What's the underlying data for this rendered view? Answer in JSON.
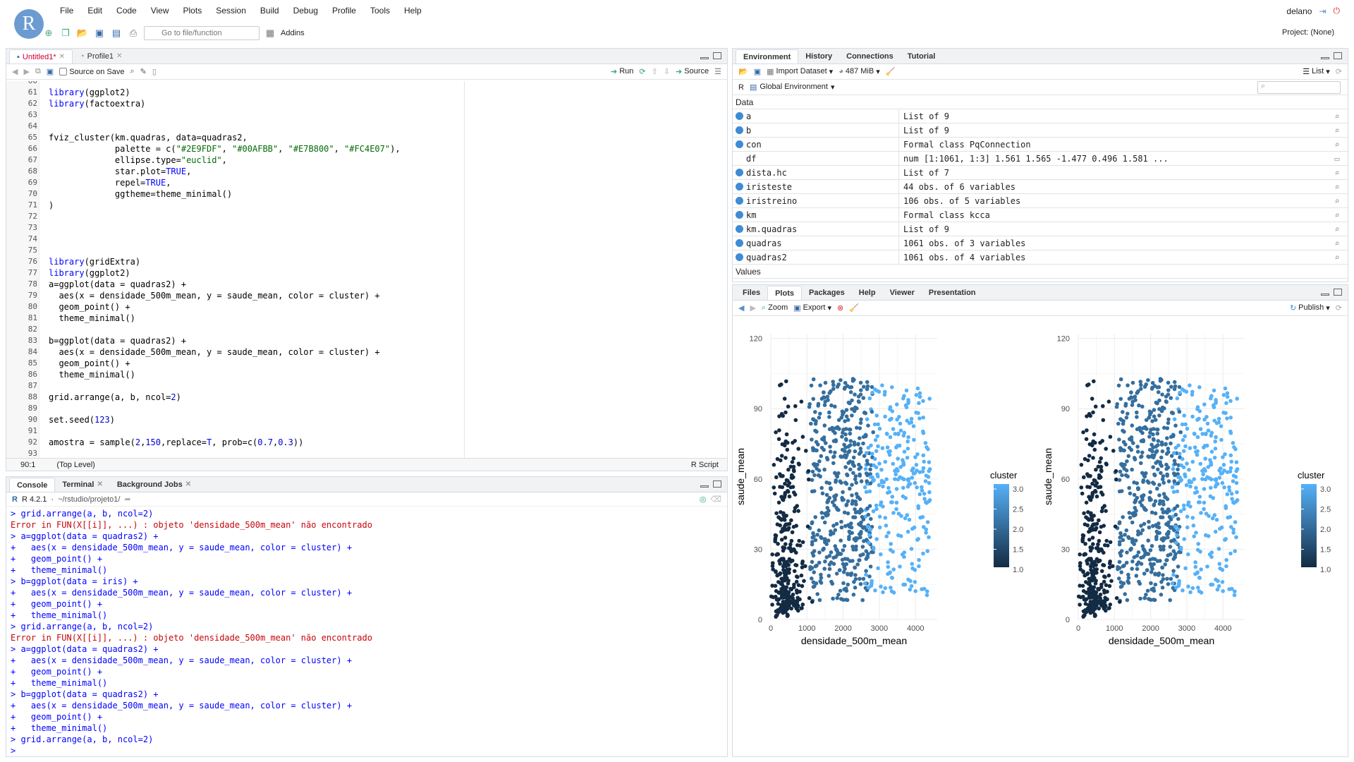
{
  "menu": [
    "File",
    "Edit",
    "Code",
    "View",
    "Plots",
    "Session",
    "Build",
    "Debug",
    "Profile",
    "Tools",
    "Help"
  ],
  "logo": "R",
  "user": "delano",
  "toolbar": {
    "goto_placeholder": "Go to file/function",
    "addins": "Addins"
  },
  "project": "Project: (None)",
  "editor": {
    "tabs": [
      {
        "label": "Untitled1*",
        "active": true
      },
      {
        "label": "Profile1",
        "active": false
      }
    ],
    "source_on_save": "Source on Save",
    "run": "Run",
    "source": "Source",
    "status_pos": "90:1",
    "status_scope": "(Top Level)",
    "status_type": "R Script",
    "lines": [
      {
        "n": "60",
        "t": ""
      },
      {
        "n": "61",
        "t": "library(ggplot2)"
      },
      {
        "n": "62",
        "t": "library(factoextra)"
      },
      {
        "n": "63",
        "t": ""
      },
      {
        "n": "64",
        "t": ""
      },
      {
        "n": "65",
        "t": "fviz_cluster(km.quadras, data=quadras2,"
      },
      {
        "n": "66",
        "t": "             palette = c(\"#2E9FDF\", \"#00AFBB\", \"#E7B800\", \"#FC4E07\"),"
      },
      {
        "n": "67",
        "t": "             ellipse.type=\"euclid\","
      },
      {
        "n": "68",
        "t": "             star.plot=TRUE,"
      },
      {
        "n": "69",
        "t": "             repel=TRUE,"
      },
      {
        "n": "70",
        "t": "             ggtheme=theme_minimal()"
      },
      {
        "n": "71",
        "t": ")"
      },
      {
        "n": "72",
        "t": ""
      },
      {
        "n": "73",
        "t": ""
      },
      {
        "n": "74",
        "t": ""
      },
      {
        "n": "75",
        "t": ""
      },
      {
        "n": "76",
        "t": "library(gridExtra)"
      },
      {
        "n": "77",
        "t": "library(ggplot2)"
      },
      {
        "n": "78",
        "t": "a=ggplot(data = quadras2) +"
      },
      {
        "n": "79",
        "t": "  aes(x = densidade_500m_mean, y = saude_mean, color = cluster) +"
      },
      {
        "n": "80",
        "t": "  geom_point() +"
      },
      {
        "n": "81",
        "t": "  theme_minimal()"
      },
      {
        "n": "82",
        "t": ""
      },
      {
        "n": "83",
        "t": "b=ggplot(data = quadras2) +"
      },
      {
        "n": "84",
        "t": "  aes(x = densidade_500m_mean, y = saude_mean, color = cluster) +"
      },
      {
        "n": "85",
        "t": "  geom_point() +"
      },
      {
        "n": "86",
        "t": "  theme_minimal()"
      },
      {
        "n": "87",
        "t": ""
      },
      {
        "n": "88",
        "t": "grid.arrange(a, b, ncol=2)"
      },
      {
        "n": "89",
        "t": ""
      },
      {
        "n": "90",
        "t": "set.seed(123)"
      },
      {
        "n": "91",
        "t": ""
      },
      {
        "n": "92",
        "t": "amostra = sample(2,150,replace=T, prob=c(0.7,0.3))"
      },
      {
        "n": "93",
        "t": ""
      }
    ]
  },
  "console": {
    "tabs": [
      "Console",
      "Terminal",
      "Background Jobs"
    ],
    "version": "R 4.2.1",
    "path": "~/rstudio/projeto1/",
    "lines": [
      {
        "k": "cmd",
        "t": "> grid.arrange(a, b, ncol=2)"
      },
      {
        "k": "err",
        "t": "Error in FUN(X[[i]], ...) : objeto 'densidade_500m_mean' não encontrado"
      },
      {
        "k": "cmd",
        "t": "> a=ggplot(data = quadras2) +"
      },
      {
        "k": "cmd",
        "t": "+   aes(x = densidade_500m_mean, y = saude_mean, color = cluster) +"
      },
      {
        "k": "cmd",
        "t": "+   geom_point() +"
      },
      {
        "k": "cmd",
        "t": "+   theme_minimal()"
      },
      {
        "k": "cmd",
        "t": "> b=ggplot(data = iris) +"
      },
      {
        "k": "cmd",
        "t": "+   aes(x = densidade_500m_mean, y = saude_mean, color = cluster) +"
      },
      {
        "k": "cmd",
        "t": "+   geom_point() +"
      },
      {
        "k": "cmd",
        "t": "+   theme_minimal()"
      },
      {
        "k": "cmd",
        "t": "> grid.arrange(a, b, ncol=2)"
      },
      {
        "k": "err",
        "t": "Error in FUN(X[[i]], ...) : objeto 'densidade_500m_mean' não encontrado"
      },
      {
        "k": "cmd",
        "t": "> a=ggplot(data = quadras2) +"
      },
      {
        "k": "cmd",
        "t": "+   aes(x = densidade_500m_mean, y = saude_mean, color = cluster) +"
      },
      {
        "k": "cmd",
        "t": "+   geom_point() +"
      },
      {
        "k": "cmd",
        "t": "+   theme_minimal()"
      },
      {
        "k": "cmd",
        "t": "> b=ggplot(data = quadras2) +"
      },
      {
        "k": "cmd",
        "t": "+   aes(x = densidade_500m_mean, y = saude_mean, color = cluster) +"
      },
      {
        "k": "cmd",
        "t": "+   geom_point() +"
      },
      {
        "k": "cmd",
        "t": "+   theme_minimal()"
      },
      {
        "k": "cmd",
        "t": "> grid.arrange(a, b, ncol=2)"
      },
      {
        "k": "cmd",
        "t": "> "
      }
    ]
  },
  "environment": {
    "tabs": [
      "Environment",
      "History",
      "Connections",
      "Tutorial"
    ],
    "import_dataset": "Import Dataset",
    "memory": "487 MiB",
    "view_mode": "List",
    "lang": "R",
    "scope": "Global Environment",
    "section_data": "Data",
    "section_values": "Values",
    "rows": [
      {
        "name": "a",
        "value": "List of  9",
        "dot": true
      },
      {
        "name": "b",
        "value": "List of  9",
        "dot": true
      },
      {
        "name": "con",
        "value": "Formal class  PqConnection",
        "dot": true
      },
      {
        "name": "df",
        "value": "num [1:1061, 1:3] 1.561 1.565 -1.477 0.496 1.581 ...",
        "dot": false
      },
      {
        "name": "dista.hc",
        "value": "List of  7",
        "dot": true
      },
      {
        "name": "iristeste",
        "value": "44 obs. of 6 variables",
        "dot": true
      },
      {
        "name": "iristreino",
        "value": "106 obs. of 5 variables",
        "dot": true
      },
      {
        "name": "km",
        "value": "Formal class  kcca",
        "dot": true
      },
      {
        "name": "km.quadras",
        "value": "List of  9",
        "dot": true
      },
      {
        "name": "quadras",
        "value": "1061 obs. of 3 variables",
        "dot": true
      },
      {
        "name": "quadras2",
        "value": "1061 obs. of 4 variables",
        "dot": true
      }
    ]
  },
  "plots_pane": {
    "tabs": [
      "Files",
      "Plots",
      "Packages",
      "Help",
      "Viewer",
      "Presentation"
    ],
    "zoom": "Zoom",
    "export": "Export",
    "publish": "Publish"
  },
  "chart_data": [
    {
      "type": "scatter",
      "xlabel": "densidade_500m_mean",
      "ylabel": "saude_mean",
      "xlim": [
        0,
        4600
      ],
      "ylim": [
        0,
        122
      ],
      "xticks": [
        "0",
        "1000",
        "2000",
        "3000",
        "4000"
      ],
      "yticks": [
        "0",
        "30",
        "60",
        "90",
        "120"
      ],
      "legend_title": "cluster",
      "legend_ticks": [
        "3.0",
        "2.5",
        "2.0",
        "1.5",
        "1.0"
      ],
      "color_low": "#132B43",
      "color_high": "#56B1F7",
      "grid": true
    },
    {
      "type": "scatter",
      "xlabel": "densidade_500m_mean",
      "ylabel": "saude_mean",
      "xlim": [
        0,
        4600
      ],
      "ylim": [
        0,
        122
      ],
      "xticks": [
        "0",
        "1000",
        "2000",
        "3000",
        "4000"
      ],
      "yticks": [
        "0",
        "30",
        "60",
        "90",
        "120"
      ],
      "legend_title": "cluster",
      "legend_ticks": [
        "3.0",
        "2.5",
        "2.0",
        "1.5",
        "1.0"
      ],
      "color_low": "#132B43",
      "color_high": "#56B1F7",
      "grid": true
    }
  ]
}
